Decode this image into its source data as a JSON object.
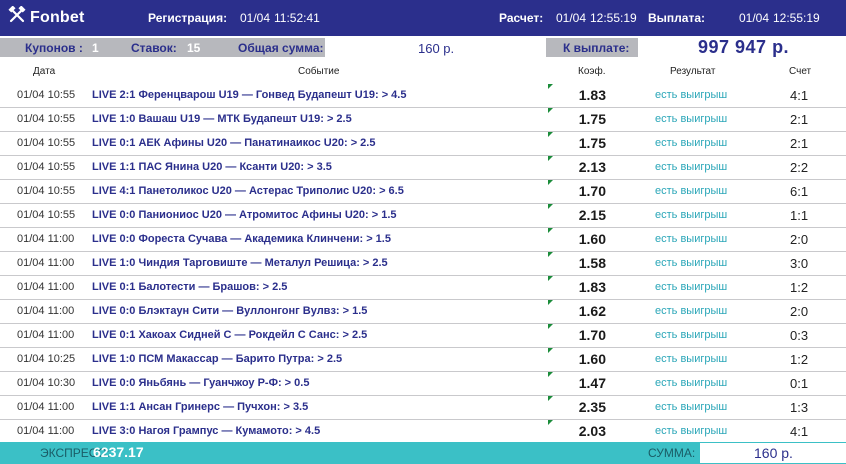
{
  "header": {
    "brand": "Fonbet",
    "registration_label": "Регистрация:",
    "registration_date": "01/04",
    "registration_time": "11:52:41",
    "settlement_label": "Расчет:",
    "settlement_date": "01/04",
    "settlement_time": "12:55:19",
    "payout_label": "Выплата:",
    "payout_date": "01/04",
    "payout_time": "12:55:19"
  },
  "summary": {
    "coupons_label": "Купонов :",
    "coupons_value": "1",
    "bets_label": "Ставок:",
    "bets_value": "15",
    "total_label": "Общая сумма:",
    "total_value": "160 р.",
    "to_pay_label": "К выплате:",
    "to_pay_value": "997 947 р."
  },
  "columns": {
    "date": "Дата",
    "event": "Событие",
    "coef": "Коэф.",
    "result": "Результат",
    "score": "Счет"
  },
  "rows": [
    {
      "date": "01/04 10:55",
      "event": "LIVE 2:1 Ференцварош U19 — Гонвед Будапешт U19: > 4.5",
      "coef": "1.83",
      "result": "есть выигрыш",
      "score": "4:1"
    },
    {
      "date": "01/04 10:55",
      "event": "LIVE 1:0 Вашаш U19 — МТК Будапешт U19: > 2.5",
      "coef": "1.75",
      "result": "есть выигрыш",
      "score": "2:1"
    },
    {
      "date": "01/04 10:55",
      "event": "LIVE 0:1 АЕК Афины U20 — Панатинаикос U20: > 2.5",
      "coef": "1.75",
      "result": "есть выигрыш",
      "score": "2:1"
    },
    {
      "date": "01/04 10:55",
      "event": "LIVE 1:1 ПАС Янина U20 — Ксанти U20: > 3.5",
      "coef": "2.13",
      "result": "есть выигрыш",
      "score": "2:2"
    },
    {
      "date": "01/04 10:55",
      "event": "LIVE 4:1 Панетоликос U20 — Астерас Триполис U20: > 6.5",
      "coef": "1.70",
      "result": "есть выигрыш",
      "score": "6:1"
    },
    {
      "date": "01/04 10:55",
      "event": "LIVE 0:0 Паниониос U20 — Атромитос Афины U20: > 1.5",
      "coef": "2.15",
      "result": "есть выигрыш",
      "score": "1:1"
    },
    {
      "date": "01/04 11:00",
      "event": "LIVE 0:0 Фореста Сучава — Академика Клинчени: > 1.5",
      "coef": "1.60",
      "result": "есть выигрыш",
      "score": "2:0"
    },
    {
      "date": "01/04 11:00",
      "event": "LIVE 1:0 Чиндия Тарговиште — Металул Решица: > 2.5",
      "coef": "1.58",
      "result": "есть выигрыш",
      "score": "3:0"
    },
    {
      "date": "01/04 11:00",
      "event": "LIVE 0:1 Балотести — Брашов: > 2.5",
      "coef": "1.83",
      "result": "есть выигрыш",
      "score": "1:2"
    },
    {
      "date": "01/04 11:00",
      "event": "LIVE 0:0 Блэктаун Сити — Вуллонгонг Вулвз: > 1.5",
      "coef": "1.62",
      "result": "есть выигрыш",
      "score": "2:0"
    },
    {
      "date": "01/04 11:00",
      "event": "LIVE 0:1 Хакоах Сидней С — Рокдейл С Санс: > 2.5",
      "coef": "1.70",
      "result": "есть выигрыш",
      "score": "0:3"
    },
    {
      "date": "01/04 10:25",
      "event": "LIVE 1:0 ПСМ Макассар — Барито Путра: > 2.5",
      "coef": "1.60",
      "result": "есть выигрыш",
      "score": "1:2"
    },
    {
      "date": "01/04 10:30",
      "event": "LIVE 0:0 Яньбянь — Гуанчжоу Р-Ф: > 0.5",
      "coef": "1.47",
      "result": "есть выигрыш",
      "score": "0:1"
    },
    {
      "date": "01/04 11:00",
      "event": "LIVE 1:1 Ансан Гринерс — Пучхон: > 3.5",
      "coef": "2.35",
      "result": "есть выигрыш",
      "score": "1:3"
    },
    {
      "date": "01/04 11:00",
      "event": "LIVE 3:0 Нагоя Грампус — Кумамото: > 4.5",
      "coef": "2.03",
      "result": "есть выигрыш",
      "score": "4:1"
    }
  ],
  "footer": {
    "express_label": "ЭКСПРЕСС:",
    "express_value": "6237.17",
    "sum_label": "СУММА:",
    "sum_value": "160 р."
  },
  "colors": {
    "header_bg": "#2b2f8c",
    "footer_bg": "#3bc0c6",
    "summary_gray": "#b7b8bd",
    "result_text": "#2aa6b8",
    "event_text": "#2b2f8c",
    "corner_marker": "#1b8c3a"
  },
  "icons": {
    "logo": "crossed-hammers-icon"
  }
}
